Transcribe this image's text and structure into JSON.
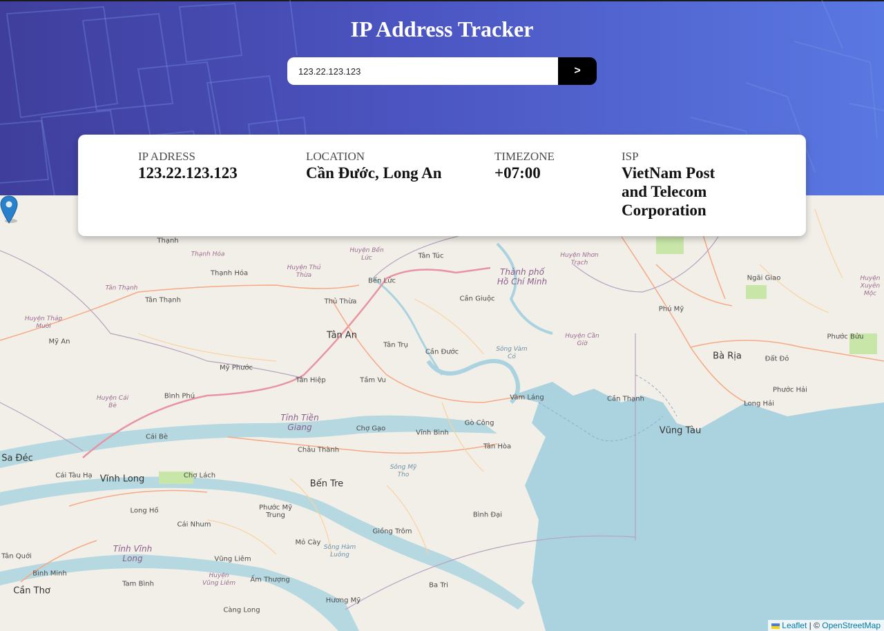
{
  "header": {
    "title": "IP Address Tracker",
    "search_value": "123.22.123.123",
    "submit_label": ">"
  },
  "info": {
    "ip_label": "IP ADRESS",
    "ip_value": "123.22.123.123",
    "location_label": "LOCATION",
    "location_value": "Cần Đước, Long An",
    "timezone_label": "TIMEZONE",
    "timezone_value": "+07:00",
    "isp_label": "ISP",
    "isp_value": "VietNam Post and Telecom Corporation"
  },
  "map": {
    "labels": {
      "thanh": "Thạnh",
      "thanh_hoa_district": "Thạnh Hóa",
      "thanh_hoa": "Thạnh Hóa",
      "tan_thanh_district": "Tân Thạnh",
      "tan_thanh": "Tân Thạnh",
      "thap_muoi_district": "Huyện Tháp Mười",
      "my_an": "Mỹ An",
      "huyen_thu_thua": "Huyện Thủ Thừa",
      "huyen_ben_luc": "Huyện Bến Lức",
      "ben_luc": "Bến Lức",
      "thu_thua": "Thủ Thừa",
      "tan_an": "Tân An",
      "tan_tru": "Tân Trụ",
      "can_duoc": "Cần Đước",
      "tan_tuc": "Tân Túc",
      "hcm_city": "Thành phố Hồ Chí Minh",
      "can_giuoc": "Cần Giuộc",
      "nhon_trach": "Huyện Nhơn Trạch",
      "ngai_giao": "Ngãi Giao",
      "xuyen_moc": "Huyện Xuyên Mộc",
      "phu_my": "Phú Mỹ",
      "phuoc_buu": "Phước Bửu",
      "ba_ria": "Bà Rịa",
      "dat_do": "Đất Đỏ",
      "can_gio": "Huyện Cần Giờ",
      "song_vam_co": "Sông Vàm Cỏ",
      "my_phuoc": "Mỹ Phước",
      "tan_hiep": "Tân Hiệp",
      "tam_vu": "Tầm Vu",
      "cai_be_district": "Huyện Cái Bè",
      "binh_phu": "Bình Phú",
      "tien_giang": "Tỉnh Tiền Giang",
      "cho_gao": "Chợ Gạo",
      "vinh_binh": "Vĩnh Bình",
      "vam_lang": "Vàm Láng",
      "go_cong": "Gò Công",
      "can_thanh": "Cần Thạnh",
      "phuoc_hai": "Phước Hải",
      "long_hai": "Long Hải",
      "vung_tau": "Vũng Tàu",
      "tan_hoa": "Tân Hòa",
      "cai_be": "Cái Bè",
      "sa_dec": "Sa Đéc",
      "chau_thanh": "Châu Thành",
      "song_my_tho": "Sông Mỹ Tho",
      "cai_tau_ha": "Cái Tàu Hạ",
      "vinh_long": "Vĩnh Long",
      "cho_lach": "Chợ Lách",
      "ben_tre": "Bến Tre",
      "long_ho": "Long Hồ",
      "cai_nhum": "Cái Nhum",
      "phuoc_my_trung": "Phước Mỹ Trung",
      "binh_dai": "Bình Đại",
      "giong_trom": "Giồng Trôm",
      "tinh_vinh_long": "Tỉnh Vĩnh Long",
      "mo_cay": "Mỏ Cày",
      "song_ham_luong": "Sông Hàm Luông",
      "tan_quoi": "Tân Quới",
      "vung_liem": "Vũng Liêm",
      "huyen_vung_liem": "Huyện Vũng Liêm",
      "binh_minh": "Bình Minh",
      "tam_binh": "Tam Bình",
      "am_thuong": "Ấm Thượng",
      "ba_tri": "Ba Tri",
      "can_tho": "Cần Thơ",
      "huong_my": "Hương Mỹ",
      "cang_long": "Càng Long"
    }
  },
  "attribution": {
    "leaflet": "Leaflet",
    "sep": "| ©",
    "osm": "OpenStreetMap"
  }
}
